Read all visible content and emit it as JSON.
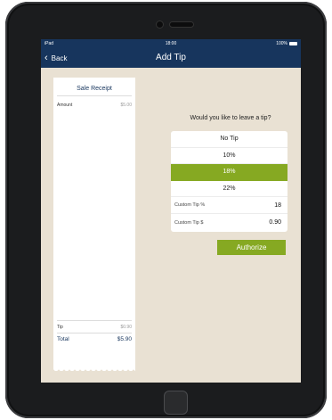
{
  "status_bar": {
    "carrier": "iPad",
    "time": "18:00",
    "battery": "100%"
  },
  "nav": {
    "back_label": "Back",
    "title": "Add Tip"
  },
  "receipt": {
    "title": "Sale Receipt",
    "amount_label": "Amount",
    "amount_value": "$5.00",
    "tip_label": "Tip",
    "tip_value": "$0.90",
    "total_label": "Total",
    "total_value": "$5.90"
  },
  "tip": {
    "question": "Would you like to leave a tip?",
    "options": [
      {
        "label": "No Tip",
        "selected": false
      },
      {
        "label": "10%",
        "selected": false
      },
      {
        "label": "18%",
        "selected": true
      },
      {
        "label": "22%",
        "selected": false
      }
    ],
    "custom_percent_label": "Custom Tip %",
    "custom_percent_value": "18",
    "custom_amount_label": "Custom Tip $",
    "custom_amount_value": "0.90"
  },
  "authorize_label": "Authorize",
  "colors": {
    "nav_bg": "#17355d",
    "accent_green": "#86a922",
    "screen_bg": "#e9e1d3"
  }
}
